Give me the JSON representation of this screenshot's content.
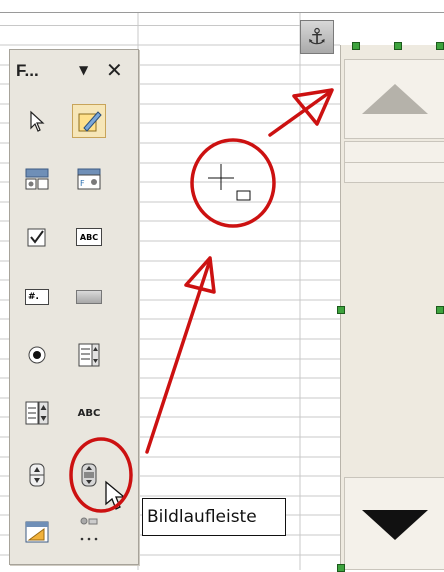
{
  "toolbar": {
    "title": "F...",
    "menu_icon": "dropdown-arrow",
    "close_icon": "close-x",
    "tools": [
      {
        "name": "select",
        "icon": "pointer-arrow-icon"
      },
      {
        "name": "design-mode",
        "icon": "design-mode-icon",
        "active": true
      },
      {
        "name": "control-properties",
        "icon": "control-properties-icon"
      },
      {
        "name": "form-properties",
        "icon": "form-properties-icon"
      },
      {
        "name": "check-box",
        "icon": "checkbox-icon"
      },
      {
        "name": "text-box",
        "icon": "text-box-icon"
      },
      {
        "name": "formatted-field",
        "icon": "formatted-field-icon"
      },
      {
        "name": "push-button",
        "icon": "push-button-icon"
      },
      {
        "name": "option-button",
        "icon": "option-button-icon"
      },
      {
        "name": "list-box",
        "icon": "list-box-icon"
      },
      {
        "name": "combo-box",
        "icon": "combo-box-icon"
      },
      {
        "name": "label-field",
        "icon": "label-field-icon"
      },
      {
        "name": "spin-button",
        "icon": "spin-button-icon"
      },
      {
        "name": "scrollbar",
        "icon": "scrollbar-icon",
        "highlighted": true
      },
      {
        "name": "form-navigator",
        "icon": "form-navigator-icon"
      },
      {
        "name": "more-controls",
        "icon": "more-controls-icon"
      }
    ],
    "text_box_glyph": "ABC",
    "formatted_field_glyph": "#.",
    "label_field_glyph": "ABC"
  },
  "tooltip": {
    "text": "Bildlaufleiste"
  },
  "anchor": {
    "icon": "anchor-icon",
    "glyph": "⚓"
  },
  "colors": {
    "annotation": "#cc1111",
    "handle": "#3ea33e",
    "toolbar_bg": "#e9e6de",
    "scrollbar_bg": "#eeeae0"
  }
}
